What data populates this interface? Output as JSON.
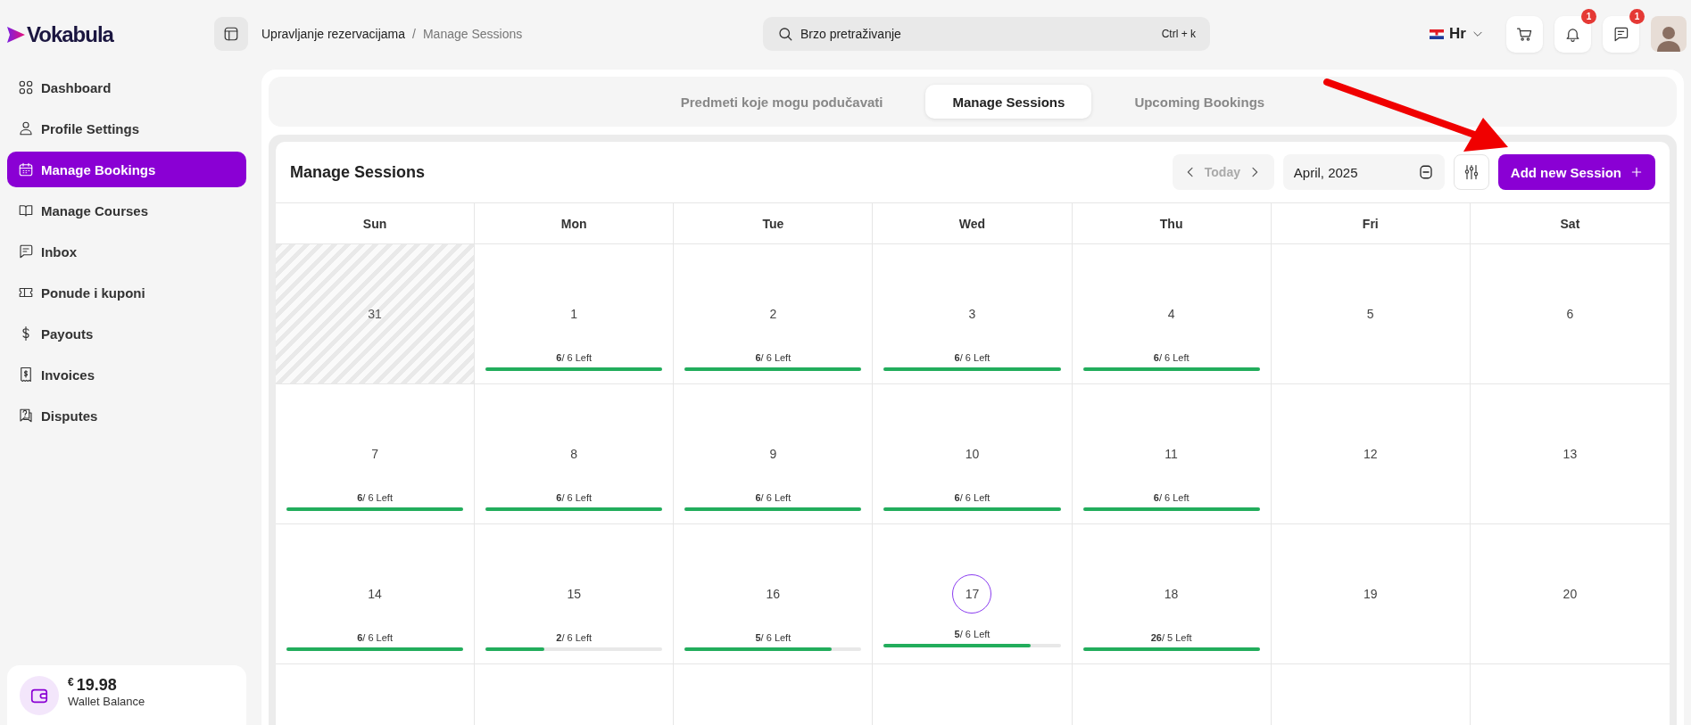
{
  "logo": {
    "text": "Vokabula"
  },
  "sidebar": {
    "items": [
      {
        "label": "Dashboard",
        "selected": false
      },
      {
        "label": "Profile Settings",
        "selected": false
      },
      {
        "label": "Manage Bookings",
        "selected": true
      },
      {
        "label": "Manage Courses",
        "selected": false
      },
      {
        "label": "Inbox",
        "selected": false
      },
      {
        "label": "Ponude i kuponi",
        "selected": false
      },
      {
        "label": "Payouts",
        "selected": false
      },
      {
        "label": "Invoices",
        "selected": false
      },
      {
        "label": "Disputes",
        "selected": false
      }
    ],
    "wallet": {
      "currency": "€",
      "amount": "19.98",
      "label": "Wallet Balance"
    }
  },
  "breadcrumb": {
    "parent": "Upravljanje rezervacijama",
    "separator": "/",
    "current": "Manage Sessions"
  },
  "search": {
    "placeholder": "Brzo pretraživanje",
    "shortcut": "Ctrl + k"
  },
  "language": {
    "label": "Hr"
  },
  "header_buttons": [
    {
      "kind": "cart"
    },
    {
      "kind": "bell",
      "badge": "1"
    },
    {
      "kind": "chat",
      "badge": "1"
    }
  ],
  "tabs": [
    {
      "label": "Predmeti koje mogu podučavati",
      "selected": false
    },
    {
      "label": "Manage Sessions",
      "selected": true
    },
    {
      "label": "Upcoming Bookings",
      "selected": false
    }
  ],
  "calendar": {
    "title": "Manage Sessions",
    "today_button": "Today",
    "month": "April, 2025",
    "add_button": "Add new Session",
    "weekdays": [
      "Sun",
      "Mon",
      "Tue",
      "Wed",
      "Thu",
      "Fri",
      "Sat"
    ],
    "weeks": [
      [
        {
          "day": "31",
          "outside": true,
          "today": false
        },
        {
          "day": "1",
          "outside": false,
          "today": false,
          "slots": "**6**/ 6 Left",
          "level": 1
        },
        {
          "day": "2",
          "outside": false,
          "today": false,
          "slots": "**6**/ 6 Left",
          "level": 1
        },
        {
          "day": "3",
          "outside": false,
          "today": false,
          "slots": "**6**/ 6 Left",
          "level": 1
        },
        {
          "day": "4",
          "outside": false,
          "today": false,
          "slots": "**6**/ 6 Left",
          "level": 1
        },
        {
          "day": "5",
          "outside": false,
          "today": false
        },
        {
          "day": "6",
          "outside": false,
          "today": false
        }
      ],
      [
        {
          "day": "7",
          "outside": false,
          "today": false,
          "slots": "**6**/ 6 Left",
          "level": 1
        },
        {
          "day": "8",
          "outside": false,
          "today": false,
          "slots": "**6**/ 6 Left",
          "level": 1
        },
        {
          "day": "9",
          "outside": false,
          "today": false,
          "slots": "**6**/ 6 Left",
          "level": 1
        },
        {
          "day": "10",
          "outside": false,
          "today": false,
          "slots": "**6**/ 6 Left",
          "level": 1
        },
        {
          "day": "11",
          "outside": false,
          "today": false,
          "slots": "**6**/ 6 Left",
          "level": 1
        },
        {
          "day": "12",
          "outside": false,
          "today": false
        },
        {
          "day": "13",
          "outside": false,
          "today": false
        }
      ],
      [
        {
          "day": "14",
          "outside": false,
          "today": false,
          "slots": "**6**/ 6 Left",
          "level": 1
        },
        {
          "day": "15",
          "outside": false,
          "today": false,
          "slots": "**2**/ 6 Left",
          "level": 0.33
        },
        {
          "day": "16",
          "outside": false,
          "today": false,
          "slots": "**5**/ 6 Left",
          "level": 0.83
        },
        {
          "day": "17",
          "outside": false,
          "today": true,
          "slots": "**5**/ 6 Left",
          "level": 0.83
        },
        {
          "day": "18",
          "outside": false,
          "today": false,
          "slots": "**26**/ 5 Left",
          "level": 1
        },
        {
          "day": "19",
          "outside": false,
          "today": false
        },
        {
          "day": "20",
          "outside": false,
          "today": false
        }
      ]
    ]
  }
}
